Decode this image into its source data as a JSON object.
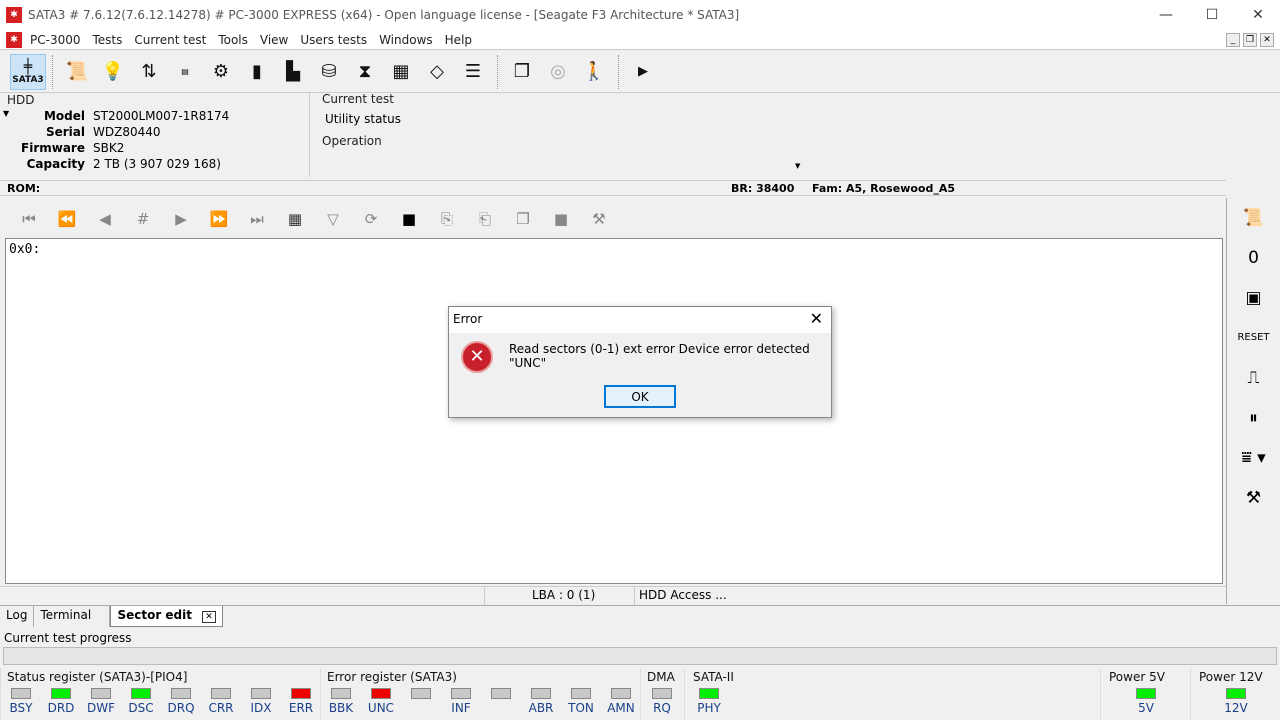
{
  "window": {
    "title": "SATA3 # 7.6.12(7.6.12.14278) # PC-3000 EXPRESS (x64) - Open language license - [Seagate F3 Architecture * SATA3]",
    "minimize": "—",
    "maximize": "☐",
    "close": "✕"
  },
  "menu": [
    "PC-3000",
    "Tests",
    "Current test",
    "Tools",
    "View",
    "Users tests",
    "Windows",
    "Help"
  ],
  "toolbar": {
    "sata_label": "SATA3",
    "next": "▶"
  },
  "hdd": {
    "title": "HDD",
    "fields": [
      {
        "k": "Model",
        "v": "ST2000LM007-1R8174"
      },
      {
        "k": "Serial",
        "v": "WDZ80440"
      },
      {
        "k": "Firmware",
        "v": "SBK2"
      },
      {
        "k": "Capacity",
        "v": "2 TB (3 907 029 168)"
      }
    ]
  },
  "current_test": {
    "title": "Current test",
    "value": "Utility status",
    "operation_title": "Operation"
  },
  "rom": {
    "label": "ROM:",
    "br": "BR: 38400",
    "fam": "Fam: A5, Rosewood_A5"
  },
  "editor": {
    "content": "0x0:"
  },
  "statusbar": {
    "lba": "LBA : 0 (1)",
    "access": "HDD Access ..."
  },
  "tabs": [
    "Log",
    "Terminal",
    "Sector edit"
  ],
  "progress": {
    "title": "Current test progress",
    "value": 0
  },
  "status_register": {
    "title": "Status register (SATA3)-[PIO4]",
    "leds": [
      {
        "n": "BSY",
        "c": "#c8c8c8"
      },
      {
        "n": "DRD",
        "c": "#00ee00"
      },
      {
        "n": "DWF",
        "c": "#c8c8c8"
      },
      {
        "n": "DSC",
        "c": "#00ee00"
      },
      {
        "n": "DRQ",
        "c": "#c8c8c8"
      },
      {
        "n": "CRR",
        "c": "#c8c8c8"
      },
      {
        "n": "IDX",
        "c": "#c8c8c8"
      },
      {
        "n": "ERR",
        "c": "#ee0000"
      }
    ]
  },
  "error_register": {
    "title": "Error register (SATA3)",
    "leds": [
      {
        "n": "BBK",
        "c": "#c8c8c8"
      },
      {
        "n": "UNC",
        "c": "#ee0000"
      },
      {
        "n": "",
        "c": "#c8c8c8"
      },
      {
        "n": "INF",
        "c": "#c8c8c8"
      },
      {
        "n": "",
        "c": "#c8c8c8"
      },
      {
        "n": "ABR",
        "c": "#c8c8c8"
      },
      {
        "n": "TON",
        "c": "#c8c8c8"
      },
      {
        "n": "AMN",
        "c": "#c8c8c8"
      }
    ]
  },
  "dma": {
    "title": "DMA",
    "led": "RQ"
  },
  "sata": {
    "title": "SATA-II",
    "led": "PHY"
  },
  "power5": {
    "title": "Power 5V",
    "led": "5V"
  },
  "power12": {
    "title": "Power 12V",
    "led": "12V"
  },
  "dialog": {
    "title": "Error",
    "message": "Read sectors (0-1) ext error Device error detected \"UNC\"",
    "ok": "OK"
  }
}
